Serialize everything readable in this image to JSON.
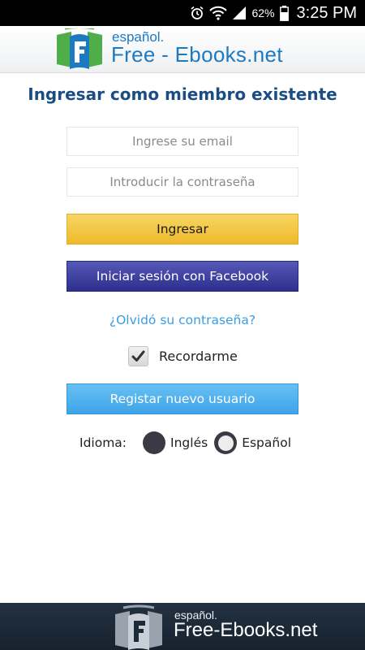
{
  "status_bar": {
    "icons": [
      "alarm-icon",
      "wifi-icon",
      "signal-icon",
      "battery-icon"
    ],
    "battery": "62%",
    "time": "3:25 PM"
  },
  "header": {
    "logo_small": "español.",
    "logo_big": "Free - Ebooks.net"
  },
  "login": {
    "title": "Ingresar como miembro existente",
    "email_placeholder": "Ingrese su email",
    "password_placeholder": "Introducir la contraseña",
    "login_button": "Ingresar",
    "facebook_button": "Iniciar sesión con Facebook",
    "forgot_link": "¿Olvidó su contraseña?",
    "remember_label": "Recordarme",
    "remember_checked": true,
    "register_button": "Registar nuevo usuario"
  },
  "language": {
    "label": "Idioma:",
    "options": [
      "Inglés",
      "Español"
    ],
    "selected": "Español"
  },
  "footer": {
    "logo_small": "español.",
    "logo_big": "Free-Ebooks.net"
  },
  "colors": {
    "title": "#1b4d84",
    "login_button": "#f2c440",
    "facebook_button": "#3b3d9e",
    "register_button": "#4fb1ee",
    "link": "#3a9de2",
    "footer_bg": "#1d2a38"
  }
}
